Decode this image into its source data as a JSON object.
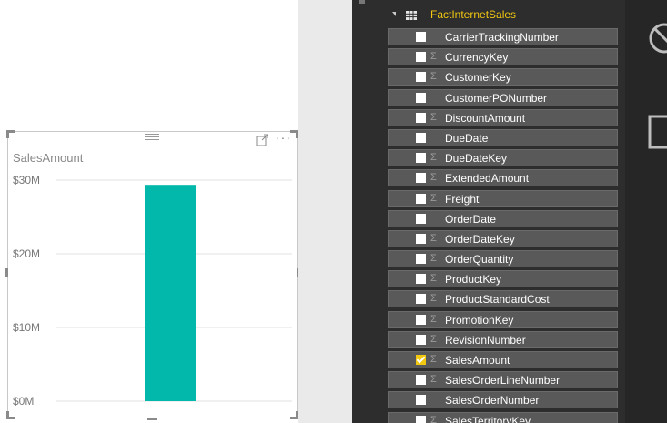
{
  "visual": {
    "title": "SalesAmount",
    "more_label": "···"
  },
  "chart_data": {
    "type": "bar",
    "title": "SalesAmount",
    "categories": [
      ""
    ],
    "values": [
      29358677
    ],
    "ylim": [
      0,
      30000000
    ],
    "yticks": [
      0,
      10000000,
      20000000,
      30000000
    ],
    "ytick_labels": [
      "$0M",
      "$10M",
      "$20M",
      "$30M"
    ],
    "grid": true,
    "bar_color": "#01b8aa"
  },
  "fields_panel": {
    "table_name": "FactInternetSales",
    "fields": [
      {
        "name": "CarrierTrackingNumber",
        "sigma": false,
        "checked": false
      },
      {
        "name": "CurrencyKey",
        "sigma": true,
        "checked": false
      },
      {
        "name": "CustomerKey",
        "sigma": true,
        "checked": false
      },
      {
        "name": "CustomerPONumber",
        "sigma": false,
        "checked": false
      },
      {
        "name": "DiscountAmount",
        "sigma": true,
        "checked": false
      },
      {
        "name": "DueDate",
        "sigma": false,
        "checked": false
      },
      {
        "name": "DueDateKey",
        "sigma": true,
        "checked": false
      },
      {
        "name": "ExtendedAmount",
        "sigma": true,
        "checked": false
      },
      {
        "name": "Freight",
        "sigma": true,
        "checked": false
      },
      {
        "name": "OrderDate",
        "sigma": false,
        "checked": false
      },
      {
        "name": "OrderDateKey",
        "sigma": true,
        "checked": false
      },
      {
        "name": "OrderQuantity",
        "sigma": true,
        "checked": false
      },
      {
        "name": "ProductKey",
        "sigma": true,
        "checked": false
      },
      {
        "name": "ProductStandardCost",
        "sigma": true,
        "checked": false
      },
      {
        "name": "PromotionKey",
        "sigma": true,
        "checked": false
      },
      {
        "name": "RevisionNumber",
        "sigma": true,
        "checked": false
      },
      {
        "name": "SalesAmount",
        "sigma": true,
        "checked": true
      },
      {
        "name": "SalesOrderLineNumber",
        "sigma": true,
        "checked": false
      },
      {
        "name": "SalesOrderNumber",
        "sigma": false,
        "checked": false
      },
      {
        "name": "SalesTerritoryKey",
        "sigma": true,
        "checked": false
      }
    ]
  },
  "colors": {
    "accent": "#f2c811",
    "bar": "#01b8aa",
    "panel_bg": "#2d2d2d",
    "field_bg": "#595959"
  },
  "icons": {
    "right_strip": [
      "no-data-icon",
      "page-icon"
    ]
  }
}
